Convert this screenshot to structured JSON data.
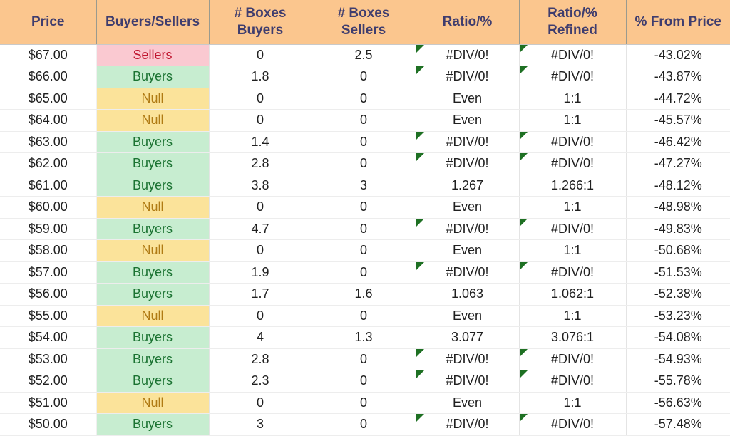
{
  "table": {
    "columns": [
      {
        "key": "price",
        "label": "Price",
        "name": "column-price"
      },
      {
        "key": "bs",
        "label": "Buyers/Sellers",
        "name": "column-buyers-sellers"
      },
      {
        "key": "boxbuy",
        "label": "# Boxes\nBuyers",
        "name": "column-boxes-buyers"
      },
      {
        "key": "boxsell",
        "label": "# Boxes\nSellers",
        "name": "column-boxes-sellers"
      },
      {
        "key": "ratio",
        "label": "Ratio/%",
        "name": "column-ratio-pct"
      },
      {
        "key": "ratioref",
        "label": "Ratio/%\nRefined",
        "name": "column-ratio-pct-refined"
      },
      {
        "key": "pct",
        "label": "% From Price",
        "name": "column-pct-from-price"
      }
    ],
    "rows": [
      {
        "price": "$67.00",
        "bs": "Sellers",
        "status": "sellers",
        "boxbuy": "0",
        "boxsell": "2.5",
        "ratio": "#DIV/0!",
        "ratio_error": true,
        "ratioref": "#DIV/0!",
        "ratioref_error": true,
        "pct": "-43.02%"
      },
      {
        "price": "$66.00",
        "bs": "Buyers",
        "status": "buyers",
        "boxbuy": "1.8",
        "boxsell": "0",
        "ratio": "#DIV/0!",
        "ratio_error": true,
        "ratioref": "#DIV/0!",
        "ratioref_error": true,
        "pct": "-43.87%"
      },
      {
        "price": "$65.00",
        "bs": "Null",
        "status": "null",
        "boxbuy": "0",
        "boxsell": "0",
        "ratio": "Even",
        "ratio_error": false,
        "ratioref": "1:1",
        "ratioref_error": false,
        "pct": "-44.72%"
      },
      {
        "price": "$64.00",
        "bs": "Null",
        "status": "null",
        "boxbuy": "0",
        "boxsell": "0",
        "ratio": "Even",
        "ratio_error": false,
        "ratioref": "1:1",
        "ratioref_error": false,
        "pct": "-45.57%"
      },
      {
        "price": "$63.00",
        "bs": "Buyers",
        "status": "buyers",
        "boxbuy": "1.4",
        "boxsell": "0",
        "ratio": "#DIV/0!",
        "ratio_error": true,
        "ratioref": "#DIV/0!",
        "ratioref_error": true,
        "pct": "-46.42%"
      },
      {
        "price": "$62.00",
        "bs": "Buyers",
        "status": "buyers",
        "boxbuy": "2.8",
        "boxsell": "0",
        "ratio": "#DIV/0!",
        "ratio_error": true,
        "ratioref": "#DIV/0!",
        "ratioref_error": true,
        "pct": "-47.27%"
      },
      {
        "price": "$61.00",
        "bs": "Buyers",
        "status": "buyers",
        "boxbuy": "3.8",
        "boxsell": "3",
        "ratio": "1.267",
        "ratio_error": false,
        "ratioref": "1.266:1",
        "ratioref_error": false,
        "pct": "-48.12%"
      },
      {
        "price": "$60.00",
        "bs": "Null",
        "status": "null",
        "boxbuy": "0",
        "boxsell": "0",
        "ratio": "Even",
        "ratio_error": false,
        "ratioref": "1:1",
        "ratioref_error": false,
        "pct": "-48.98%"
      },
      {
        "price": "$59.00",
        "bs": "Buyers",
        "status": "buyers",
        "boxbuy": "4.7",
        "boxsell": "0",
        "ratio": "#DIV/0!",
        "ratio_error": true,
        "ratioref": "#DIV/0!",
        "ratioref_error": true,
        "pct": "-49.83%"
      },
      {
        "price": "$58.00",
        "bs": "Null",
        "status": "null",
        "boxbuy": "0",
        "boxsell": "0",
        "ratio": "Even",
        "ratio_error": false,
        "ratioref": "1:1",
        "ratioref_error": false,
        "pct": "-50.68%"
      },
      {
        "price": "$57.00",
        "bs": "Buyers",
        "status": "buyers",
        "boxbuy": "1.9",
        "boxsell": "0",
        "ratio": "#DIV/0!",
        "ratio_error": true,
        "ratioref": "#DIV/0!",
        "ratioref_error": true,
        "pct": "-51.53%"
      },
      {
        "price": "$56.00",
        "bs": "Buyers",
        "status": "buyers",
        "boxbuy": "1.7",
        "boxsell": "1.6",
        "ratio": "1.063",
        "ratio_error": false,
        "ratioref": "1.062:1",
        "ratioref_error": false,
        "pct": "-52.38%"
      },
      {
        "price": "$55.00",
        "bs": "Null",
        "status": "null",
        "boxbuy": "0",
        "boxsell": "0",
        "ratio": "Even",
        "ratio_error": false,
        "ratioref": "1:1",
        "ratioref_error": false,
        "pct": "-53.23%"
      },
      {
        "price": "$54.00",
        "bs": "Buyers",
        "status": "buyers",
        "boxbuy": "4",
        "boxsell": "1.3",
        "ratio": "3.077",
        "ratio_error": false,
        "ratioref": "3.076:1",
        "ratioref_error": false,
        "pct": "-54.08%"
      },
      {
        "price": "$53.00",
        "bs": "Buyers",
        "status": "buyers",
        "boxbuy": "2.8",
        "boxsell": "0",
        "ratio": "#DIV/0!",
        "ratio_error": true,
        "ratioref": "#DIV/0!",
        "ratioref_error": true,
        "pct": "-54.93%"
      },
      {
        "price": "$52.00",
        "bs": "Buyers",
        "status": "buyers",
        "boxbuy": "2.3",
        "boxsell": "0",
        "ratio": "#DIV/0!",
        "ratio_error": true,
        "ratioref": "#DIV/0!",
        "ratioref_error": true,
        "pct": "-55.78%"
      },
      {
        "price": "$51.00",
        "bs": "Null",
        "status": "null",
        "boxbuy": "0",
        "boxsell": "0",
        "ratio": "Even",
        "ratio_error": false,
        "ratioref": "1:1",
        "ratioref_error": false,
        "pct": "-56.63%"
      },
      {
        "price": "$50.00",
        "bs": "Buyers",
        "status": "buyers",
        "boxbuy": "3",
        "boxsell": "0",
        "ratio": "#DIV/0!",
        "ratio_error": true,
        "ratioref": "#DIV/0!",
        "ratioref_error": true,
        "pct": "-57.48%"
      }
    ]
  },
  "colors": {
    "header_bg": "#FBC68E",
    "header_text": "#3F3D6E",
    "buyers_bg": "#C7EDD0",
    "buyers_text": "#1B7332",
    "sellers_bg": "#FAC9D1",
    "sellers_text": "#C0162F",
    "null_bg": "#FBE39A",
    "null_text": "#B07B14",
    "error_flag": "#1E7023"
  }
}
